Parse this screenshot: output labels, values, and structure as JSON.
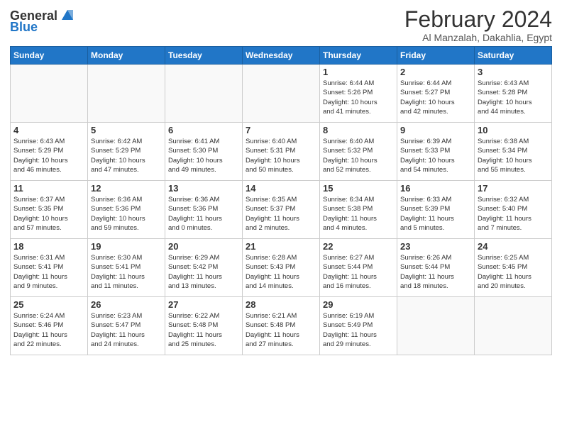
{
  "header": {
    "logo_general": "General",
    "logo_blue": "Blue",
    "month_title": "February 2024",
    "location": "Al Manzalah, Dakahlia, Egypt"
  },
  "days_of_week": [
    "Sunday",
    "Monday",
    "Tuesday",
    "Wednesday",
    "Thursday",
    "Friday",
    "Saturday"
  ],
  "weeks": [
    [
      {
        "day": "",
        "info": ""
      },
      {
        "day": "",
        "info": ""
      },
      {
        "day": "",
        "info": ""
      },
      {
        "day": "",
        "info": ""
      },
      {
        "day": "1",
        "info": "Sunrise: 6:44 AM\nSunset: 5:26 PM\nDaylight: 10 hours\nand 41 minutes."
      },
      {
        "day": "2",
        "info": "Sunrise: 6:44 AM\nSunset: 5:27 PM\nDaylight: 10 hours\nand 42 minutes."
      },
      {
        "day": "3",
        "info": "Sunrise: 6:43 AM\nSunset: 5:28 PM\nDaylight: 10 hours\nand 44 minutes."
      }
    ],
    [
      {
        "day": "4",
        "info": "Sunrise: 6:43 AM\nSunset: 5:29 PM\nDaylight: 10 hours\nand 46 minutes."
      },
      {
        "day": "5",
        "info": "Sunrise: 6:42 AM\nSunset: 5:29 PM\nDaylight: 10 hours\nand 47 minutes."
      },
      {
        "day": "6",
        "info": "Sunrise: 6:41 AM\nSunset: 5:30 PM\nDaylight: 10 hours\nand 49 minutes."
      },
      {
        "day": "7",
        "info": "Sunrise: 6:40 AM\nSunset: 5:31 PM\nDaylight: 10 hours\nand 50 minutes."
      },
      {
        "day": "8",
        "info": "Sunrise: 6:40 AM\nSunset: 5:32 PM\nDaylight: 10 hours\nand 52 minutes."
      },
      {
        "day": "9",
        "info": "Sunrise: 6:39 AM\nSunset: 5:33 PM\nDaylight: 10 hours\nand 54 minutes."
      },
      {
        "day": "10",
        "info": "Sunrise: 6:38 AM\nSunset: 5:34 PM\nDaylight: 10 hours\nand 55 minutes."
      }
    ],
    [
      {
        "day": "11",
        "info": "Sunrise: 6:37 AM\nSunset: 5:35 PM\nDaylight: 10 hours\nand 57 minutes."
      },
      {
        "day": "12",
        "info": "Sunrise: 6:36 AM\nSunset: 5:36 PM\nDaylight: 10 hours\nand 59 minutes."
      },
      {
        "day": "13",
        "info": "Sunrise: 6:36 AM\nSunset: 5:36 PM\nDaylight: 11 hours\nand 0 minutes."
      },
      {
        "day": "14",
        "info": "Sunrise: 6:35 AM\nSunset: 5:37 PM\nDaylight: 11 hours\nand 2 minutes."
      },
      {
        "day": "15",
        "info": "Sunrise: 6:34 AM\nSunset: 5:38 PM\nDaylight: 11 hours\nand 4 minutes."
      },
      {
        "day": "16",
        "info": "Sunrise: 6:33 AM\nSunset: 5:39 PM\nDaylight: 11 hours\nand 5 minutes."
      },
      {
        "day": "17",
        "info": "Sunrise: 6:32 AM\nSunset: 5:40 PM\nDaylight: 11 hours\nand 7 minutes."
      }
    ],
    [
      {
        "day": "18",
        "info": "Sunrise: 6:31 AM\nSunset: 5:41 PM\nDaylight: 11 hours\nand 9 minutes."
      },
      {
        "day": "19",
        "info": "Sunrise: 6:30 AM\nSunset: 5:41 PM\nDaylight: 11 hours\nand 11 minutes."
      },
      {
        "day": "20",
        "info": "Sunrise: 6:29 AM\nSunset: 5:42 PM\nDaylight: 11 hours\nand 13 minutes."
      },
      {
        "day": "21",
        "info": "Sunrise: 6:28 AM\nSunset: 5:43 PM\nDaylight: 11 hours\nand 14 minutes."
      },
      {
        "day": "22",
        "info": "Sunrise: 6:27 AM\nSunset: 5:44 PM\nDaylight: 11 hours\nand 16 minutes."
      },
      {
        "day": "23",
        "info": "Sunrise: 6:26 AM\nSunset: 5:44 PM\nDaylight: 11 hours\nand 18 minutes."
      },
      {
        "day": "24",
        "info": "Sunrise: 6:25 AM\nSunset: 5:45 PM\nDaylight: 11 hours\nand 20 minutes."
      }
    ],
    [
      {
        "day": "25",
        "info": "Sunrise: 6:24 AM\nSunset: 5:46 PM\nDaylight: 11 hours\nand 22 minutes."
      },
      {
        "day": "26",
        "info": "Sunrise: 6:23 AM\nSunset: 5:47 PM\nDaylight: 11 hours\nand 24 minutes."
      },
      {
        "day": "27",
        "info": "Sunrise: 6:22 AM\nSunset: 5:48 PM\nDaylight: 11 hours\nand 25 minutes."
      },
      {
        "day": "28",
        "info": "Sunrise: 6:21 AM\nSunset: 5:48 PM\nDaylight: 11 hours\nand 27 minutes."
      },
      {
        "day": "29",
        "info": "Sunrise: 6:19 AM\nSunset: 5:49 PM\nDaylight: 11 hours\nand 29 minutes."
      },
      {
        "day": "",
        "info": ""
      },
      {
        "day": "",
        "info": ""
      }
    ]
  ]
}
